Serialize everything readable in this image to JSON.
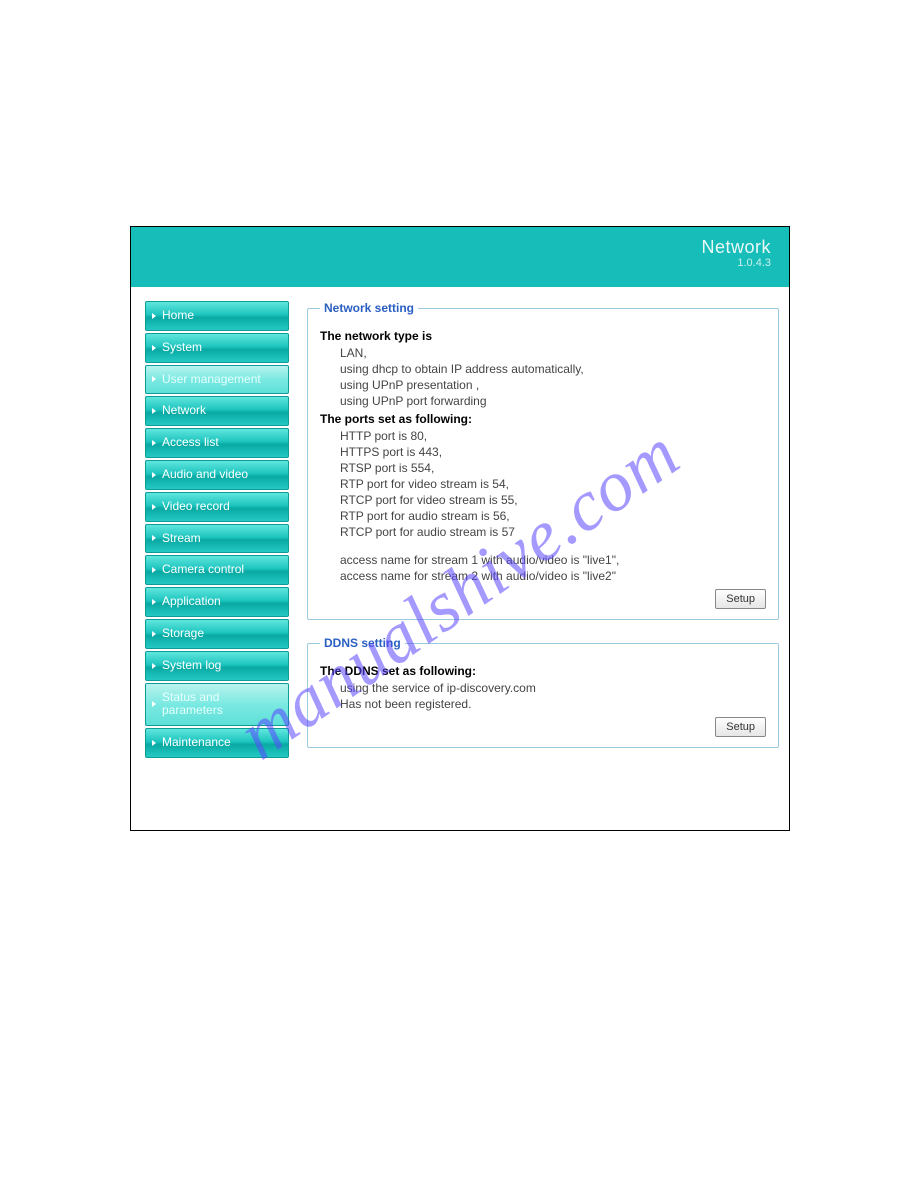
{
  "watermark": "manualshive.com",
  "header": {
    "title": "Network",
    "version": "1.0.4.3"
  },
  "nav": [
    {
      "label": "Home",
      "selected": false
    },
    {
      "label": "System",
      "selected": false
    },
    {
      "label": "User management",
      "selected": true
    },
    {
      "label": "Network",
      "selected": false
    },
    {
      "label": "Access list",
      "selected": false
    },
    {
      "label": "Audio and video",
      "selected": false
    },
    {
      "label": "Video record",
      "selected": false
    },
    {
      "label": "Stream",
      "selected": false
    },
    {
      "label": "Camera control",
      "selected": false
    },
    {
      "label": "Application",
      "selected": false
    },
    {
      "label": "Storage",
      "selected": false
    },
    {
      "label": "System log",
      "selected": false
    },
    {
      "label": "Status and parameters",
      "selected": true
    },
    {
      "label": "Maintenance",
      "selected": false
    }
  ],
  "network_setting": {
    "legend": "Network setting",
    "heading_type": "The network type is",
    "type_lines": [
      "LAN,",
      "using dhcp to obtain IP address automatically,",
      "using UPnP presentation ,",
      "using UPnP port forwarding"
    ],
    "heading_ports": "The ports set as following:",
    "port_lines": [
      "HTTP port is 80,",
      "HTTPS port is 443,",
      "RTSP port is 554,",
      "RTP port for video stream is 54,",
      "RTCP port for video stream is 55,",
      "RTP port for audio stream is 56,",
      "RTCP port for audio stream is 57"
    ],
    "access_lines": [
      "access name for stream 1 with audio/video is \"live1\",",
      "access name for stream 2 with audio/video is \"live2\""
    ],
    "setup_label": "Setup"
  },
  "ddns_setting": {
    "legend": "DDNS setting",
    "heading": "The DDNS set as following:",
    "lines": [
      "using the service of ip-discovery.com",
      "Has not been registered."
    ],
    "setup_label": "Setup"
  }
}
